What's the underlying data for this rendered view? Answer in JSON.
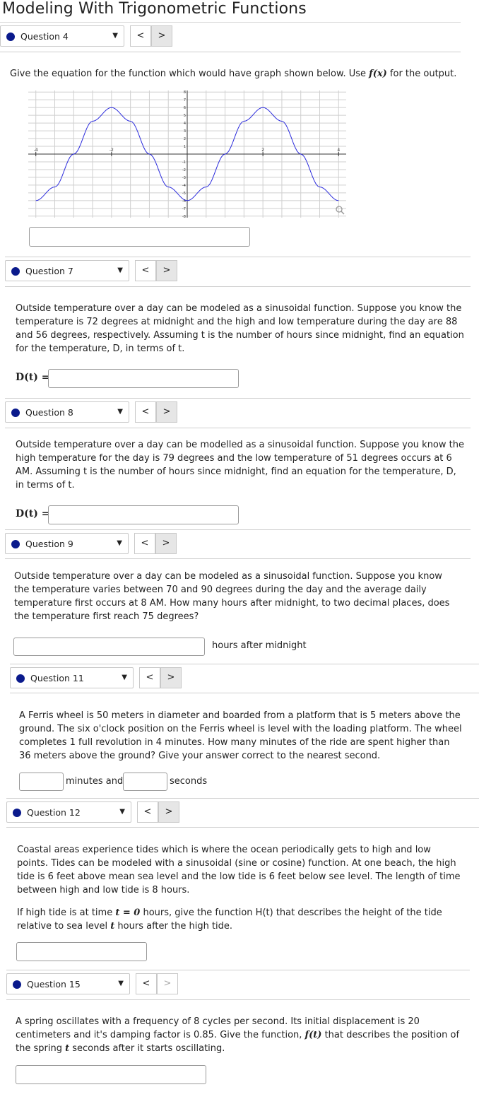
{
  "page": {
    "title": "Modeling With Trigonometric Functions"
  },
  "questions": [
    {
      "id": "q4",
      "select_label": "Question 4",
      "prompt_pre": "Give the equation for the function which would have graph shown below. Use ",
      "prompt_math": "f(x)",
      "prompt_post": " for the output."
    },
    {
      "id": "q7",
      "select_label": "Question 7",
      "prompt": "Outside temperature over a day can be modeled as a sinusoidal function. Suppose you know the temperature is 72 degrees at midnight and the high and low temperature during the day are 88 and 56 degrees, respectively. Assuming t is the number of hours since midnight, find an equation for the temperature, D, in terms of t.",
      "answer_label": "D(t) ="
    },
    {
      "id": "q8",
      "select_label": "Question 8",
      "prompt": "Outside temperature over a day can be modelled as a sinusoidal function. Suppose you know the high temperature for the day is 79 degrees and the low temperature of 51 degrees occurs at 6 AM. Assuming t is the number of hours since midnight, find an equation for the temperature, D, in terms of t.",
      "answer_label": "D(t) ="
    },
    {
      "id": "q9",
      "select_label": "Question 9",
      "prompt": "Outside temperature over a day can be modeled as a sinusoidal function. Suppose you know the temperature varies between 70 and 90 degrees during the day and the average daily temperature first occurs at 8 AM. How many hours after midnight, to two decimal places, does the temperature first reach 75 degrees?",
      "answer_suffix": "hours after midnight"
    },
    {
      "id": "q11",
      "select_label": "Question 11",
      "prompt": "A Ferris wheel is 50 meters in diameter and boarded from a platform that is 5 meters above the ground. The six o'clock position on the Ferris wheel is level with the loading platform. The wheel completes 1 full revolution in 4 minutes. How many minutes of the ride are spent higher than 36 meters above the ground? Give your answer correct to the nearest second.",
      "unit_minutes": "minutes and",
      "unit_seconds": "seconds"
    },
    {
      "id": "q12",
      "select_label": "Question 12",
      "prompt": "Coastal areas experience tides which is where the ocean periodically gets to high and low points. Tides can be modeled with a sinusoidal (sine or cosine) function. At one beach, the high tide is 6 feet above mean sea level and the low tide is 6 feet below see level. The length of time between high and low tide is 8 hours.",
      "prompt2_a": "If high tide is at time ",
      "prompt2_math1": "t = 0",
      "prompt2_b": " hours, give the function H(t) that describes the height of the tide relative to sea level ",
      "prompt2_math2": "t",
      "prompt2_c": " hours after the high tide."
    },
    {
      "id": "q15",
      "select_label": "Question 15",
      "prompt_a": "A spring oscillates with a frequency of 8 cycles per second. Its initial displacement is 20 centimeters and it's damping factor is 0.85. Give the function, ",
      "prompt_math1": "f(t)",
      "prompt_b": " that describes the position of the spring ",
      "prompt_math2": "t",
      "prompt_c": " seconds after it starts oscillating."
    }
  ],
  "nav": {
    "prev": "<",
    "next": ">",
    "caret": "▼"
  },
  "chart_data": {
    "type": "line",
    "xlim": [
      -4.2,
      4.2
    ],
    "ylim": [
      -8.2,
      8.2
    ],
    "grid": true,
    "x_tick_labels": [
      "-4",
      "-2",
      "2",
      "4"
    ],
    "y_tick_labels": [
      "8",
      "7",
      "6",
      "5",
      "4",
      "3",
      "2",
      "1",
      "-1",
      "-2",
      "-3",
      "-4",
      "-5",
      "-6",
      "-7",
      "-8"
    ],
    "series": [
      {
        "color": "#2b2bdc",
        "x": [
          -4,
          -3.5,
          -3,
          -2.5,
          -2,
          -1.5,
          -1,
          -0.5,
          0,
          0.5,
          1,
          1.5,
          2,
          2.5,
          3,
          3.5,
          4
        ],
        "y": [
          -6,
          -4.24,
          0,
          4.24,
          6,
          4.24,
          0,
          -4.24,
          -6,
          -4.24,
          0,
          4.24,
          6,
          4.24,
          0,
          -4.24,
          -6
        ]
      }
    ]
  },
  "icons": {
    "zoom": "magnifier-icon"
  }
}
